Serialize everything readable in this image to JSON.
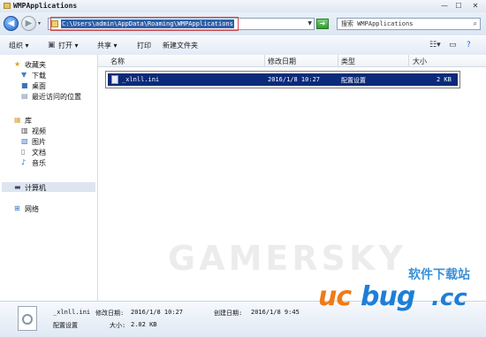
{
  "window": {
    "title": "WMPApplications",
    "controls": [
      "—",
      "☐",
      "✕"
    ]
  },
  "address": {
    "path": "C:\\Users\\admin\\AppData\\Roaming\\WMPApplications",
    "search_placeholder": "搜索 WMPApplications"
  },
  "toolbar": {
    "organize": "组织 ▾",
    "open": "打开 ▾",
    "share": "共享 ▾",
    "print": "打印",
    "new_folder": "新建文件夹"
  },
  "nav": {
    "favorites": "收藏夹",
    "downloads": "下载",
    "desktop": "桌面",
    "recent": "最近访问的位置",
    "libraries": "库",
    "videos": "视频",
    "pictures": "图片",
    "documents": "文档",
    "music": "音乐",
    "computer": "计算机",
    "network": "网络"
  },
  "columns": {
    "name": "名称",
    "modified": "修改日期",
    "type": "类型",
    "size": "大小"
  },
  "files": [
    {
      "name": "_xlnll.ini",
      "modified": "2016/1/8 10:27",
      "type": "配置设置",
      "size": "2 KB"
    }
  ],
  "details": {
    "filename": "_xlnll.ini",
    "modified_label": "修改日期:",
    "modified_value": "2016/1/8 10:27",
    "created_label": "创建日期:",
    "created_value": "2016/1/8 9:45",
    "type": "配置设置",
    "size_label": "大小:",
    "size_value": "2.02 KB"
  },
  "watermark": {
    "text": "GAMERSKY",
    "logo_cn": "软件下载站",
    "logo_uc": "uc",
    "logo_bug": "bug",
    "logo_cc": ".cc"
  }
}
